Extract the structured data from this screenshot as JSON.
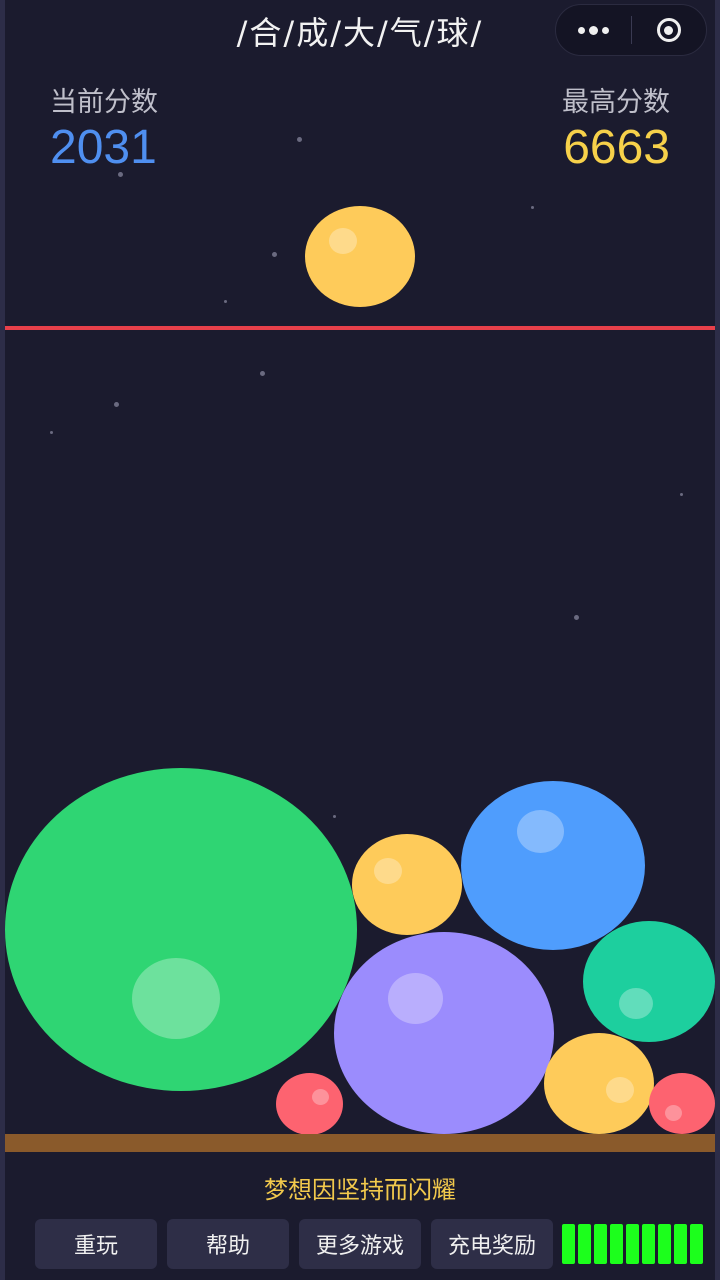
{
  "header": {
    "title": "/合/成/大/气/球/",
    "capsule": {
      "more_icon": "more-dots-icon",
      "close_icon": "target-icon"
    }
  },
  "scores": {
    "current_label": "当前分数",
    "current_value": "2031",
    "best_label": "最高分数",
    "best_value": "6663"
  },
  "colors": {
    "background": "#1b1b2e",
    "danger_line": "#e8404a",
    "ground": "#8a5a2b",
    "current_score": "#4f8ff0",
    "best_score": "#f7d14a",
    "energy": "#1cff1c"
  },
  "game": {
    "next_ball_color": "#fecb5a",
    "balls": [
      {
        "color": "#2fd573"
      },
      {
        "color": "#fecb5a"
      },
      {
        "color": "#4f9dfd"
      },
      {
        "color": "#9b8cfd"
      },
      {
        "color": "#1dcf9e"
      },
      {
        "color": "#fd6370"
      },
      {
        "color": "#fecb5a"
      },
      {
        "color": "#fd6370"
      }
    ]
  },
  "footer": {
    "motto": "梦想因坚持而闪耀",
    "buttons": {
      "replay": "重玩",
      "help": "帮助",
      "more_games": "更多游戏",
      "charge_reward": "充电奖励"
    },
    "energy": {
      "filled": 9,
      "total": 9
    }
  }
}
